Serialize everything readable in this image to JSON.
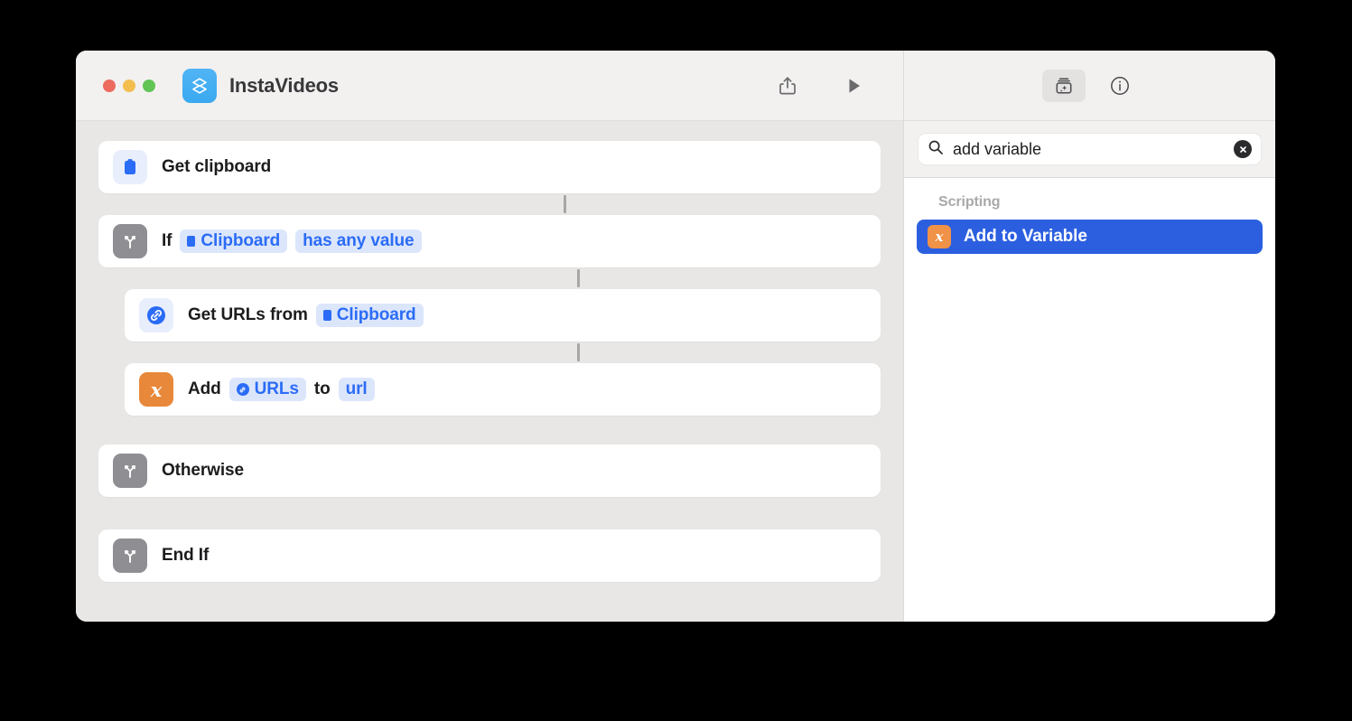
{
  "window": {
    "title": "InstaVideos",
    "app_icon": "shortcuts-stack-icon",
    "traffic_lights": [
      {
        "name": "close",
        "color": "#ed6a5f"
      },
      {
        "name": "minimize",
        "color": "#f4bd50"
      },
      {
        "name": "zoom",
        "color": "#61c454"
      }
    ]
  },
  "toolbar": {
    "share_icon": "share-icon",
    "play_icon": "play-icon",
    "library_icon": "action-library-icon",
    "info_icon": "info-icon"
  },
  "workflow": {
    "rows": [
      {
        "id": "get-clipboard",
        "icon": "clipboard-icon",
        "icon_style": "clipboard",
        "indent": false,
        "label": "Get clipboard",
        "tokens": []
      },
      {
        "id": "if",
        "icon": "branch-icon",
        "icon_style": "branch",
        "indent": false,
        "label": "If",
        "tokens": [
          {
            "type": "chip",
            "glyph": "clipboard-mini-icon",
            "text": "Clipboard"
          },
          {
            "type": "chip-plain",
            "text": "has any value"
          }
        ]
      },
      {
        "id": "get-urls",
        "icon": "link-icon",
        "icon_style": "link",
        "indent": true,
        "label": "Get URLs from",
        "tokens": [
          {
            "type": "chip",
            "glyph": "clipboard-mini-icon",
            "text": "Clipboard"
          }
        ]
      },
      {
        "id": "add-to-variable",
        "icon": "variable-x-icon",
        "icon_style": "variable",
        "indent": true,
        "label": "Add",
        "tokens": [
          {
            "type": "chip",
            "glyph": "link-mini-icon",
            "text": "URLs"
          },
          {
            "type": "word",
            "text": "to"
          },
          {
            "type": "chip-var",
            "text": "url"
          }
        ]
      },
      {
        "id": "otherwise",
        "icon": "branch-icon",
        "icon_style": "branch",
        "indent": false,
        "label": "Otherwise",
        "tokens": []
      },
      {
        "id": "end-if",
        "icon": "branch-icon",
        "icon_style": "branch",
        "indent": false,
        "label": "End If",
        "tokens": []
      }
    ]
  },
  "sidebar": {
    "search": {
      "icon": "search-icon",
      "value": "add variable",
      "placeholder": "Search",
      "clear_icon": "clear-icon"
    },
    "results": {
      "group_label": "Scripting",
      "items": [
        {
          "label": "Add to Variable",
          "icon": "variable-x-icon",
          "selected": true
        }
      ]
    }
  },
  "colors": {
    "accent_blue": "#2b6cf6",
    "selection_blue": "#2c5fe0",
    "variable_orange": "#e8883a",
    "branch_gray": "#8e8e93",
    "canvas": "#e8e7e6",
    "titlebar": "#f2f1f0"
  }
}
